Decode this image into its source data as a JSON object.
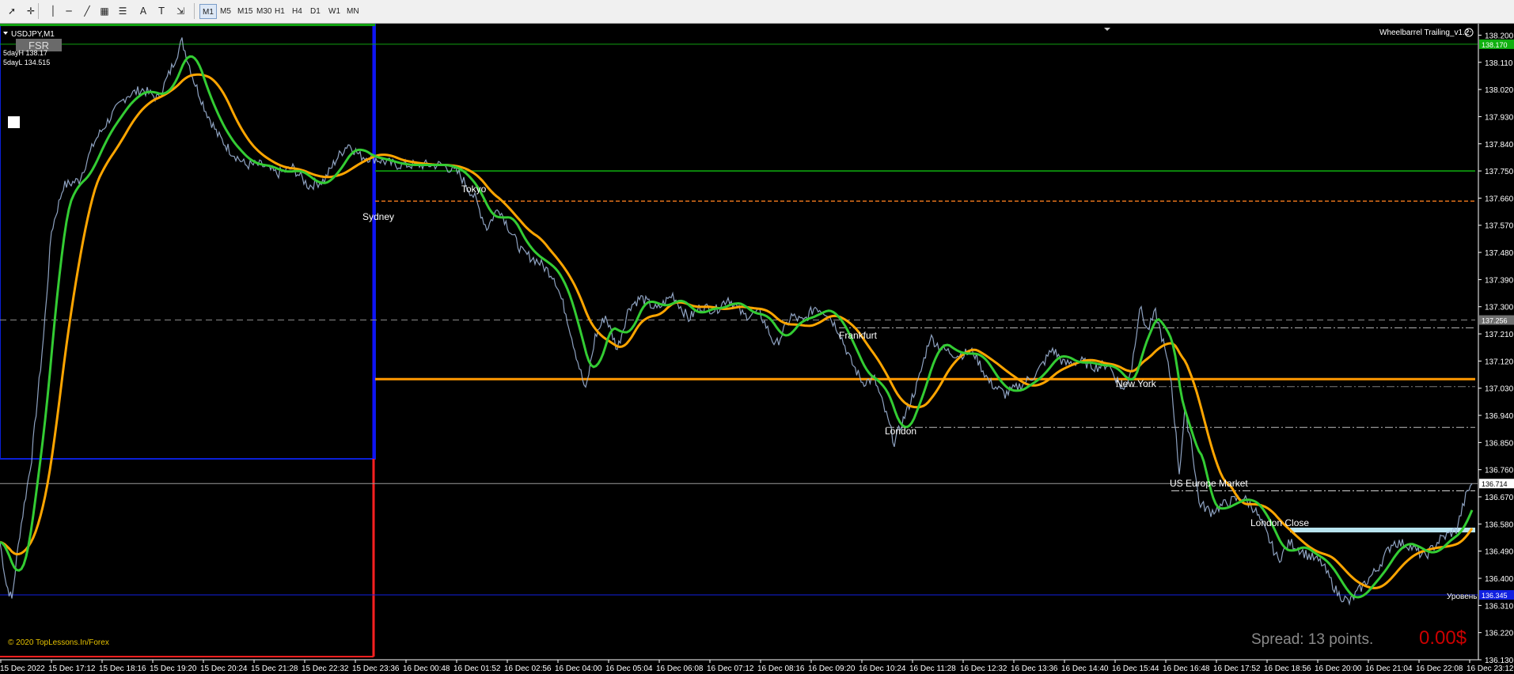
{
  "toolbar": {
    "tools": [
      {
        "icon": "cursor-icon",
        "glyph": "➚"
      },
      {
        "icon": "crosshair-icon",
        "glyph": "✛"
      },
      {
        "icon": "vertical-line-icon",
        "glyph": "│"
      },
      {
        "icon": "horizontal-line-icon",
        "glyph": "─"
      },
      {
        "icon": "trendline-icon",
        "glyph": "╱"
      },
      {
        "icon": "channel-icon",
        "glyph": "▦"
      },
      {
        "icon": "fibonacci-icon",
        "glyph": "☰"
      },
      {
        "icon": "text-icon",
        "glyph": "A"
      },
      {
        "icon": "text-label-icon",
        "glyph": "T"
      },
      {
        "icon": "shapes-dropdown-icon",
        "glyph": "⇲"
      }
    ],
    "timeframes": [
      "M1",
      "M5",
      "M15",
      "M30",
      "H1",
      "H4",
      "D1",
      "W1",
      "MN"
    ],
    "active_timeframe": "M1"
  },
  "chart": {
    "symbol": "USDJPY,M1",
    "fsr_label": "FSR",
    "five_day_high": "5dayH 138.17",
    "five_day_low": "5dayL 134.515",
    "ea_name": "Wheelbarrel Trailing_v1.2",
    "copyright": "© 2020 TopLessons.In/Forex",
    "spread": "Spread: 13 points.",
    "profit": "0.00$",
    "level_label": "Уровень",
    "colors": {
      "background": "#000000",
      "fast_ma": "#33cc33",
      "slow_ma": "#ffa500",
      "price": "#9db4d6",
      "axis_text": "#ffffff",
      "profit": "#cc0000",
      "high_line": "#10a010",
      "low_line": "#0a1fd8"
    }
  },
  "sessions": [
    {
      "name": "Sydney"
    },
    {
      "name": "Tokyo"
    },
    {
      "name": "Frankfurt"
    },
    {
      "name": "London"
    },
    {
      "name": "New York"
    },
    {
      "name": "US Europe Market"
    },
    {
      "name": "London Close"
    }
  ],
  "price_axis": {
    "ticks": [
      "138.200",
      "138.110",
      "138.020",
      "137.930",
      "137.840",
      "137.750",
      "137.660",
      "137.570",
      "137.480",
      "137.390",
      "137.300",
      "137.210",
      "137.120",
      "137.030",
      "136.940",
      "136.850",
      "136.760",
      "136.670",
      "136.580",
      "136.490",
      "136.400",
      "136.310",
      "136.220",
      "136.130"
    ],
    "ymin": 136.13,
    "ymax": 138.23,
    "high_tag": "138.170",
    "mid_tag": "137.256",
    "current_tag": "136.714",
    "low_tag": "136.345"
  },
  "time_axis": {
    "labels": [
      "15 Dec 2022",
      "15 Dec 17:12",
      "15 Dec 18:16",
      "15 Dec 19:20",
      "15 Dec 20:24",
      "15 Dec 21:28",
      "15 Dec 22:32",
      "15 Dec 23:36",
      "16 Dec 00:48",
      "16 Dec 01:52",
      "16 Dec 02:56",
      "16 Dec 04:00",
      "16 Dec 05:04",
      "16 Dec 06:08",
      "16 Dec 07:12",
      "16 Dec 08:16",
      "16 Dec 09:20",
      "16 Dec 10:24",
      "16 Dec 11:28",
      "16 Dec 12:32",
      "16 Dec 13:36",
      "16 Dec 14:40",
      "16 Dec 15:44",
      "16 Dec 16:48",
      "16 Dec 17:52",
      "16 Dec 18:56",
      "16 Dec 20:00",
      "16 Dec 21:04",
      "16 Dec 22:08",
      "16 Dec 23:12"
    ]
  },
  "levels": {
    "five_day_high": 138.17,
    "tokyo_high": 137.75,
    "tokyo_low_dashed": 137.65,
    "dashed_gray": 137.256,
    "frankfurt_dashdot": 137.23,
    "orange_level": 137.06,
    "newyork_dashdot": 137.035,
    "london_dashdot": 136.9,
    "current_price": 136.714,
    "uscorner_dashdot": 136.69,
    "londonclose_band": 136.56,
    "blue_level": 136.345
  }
}
